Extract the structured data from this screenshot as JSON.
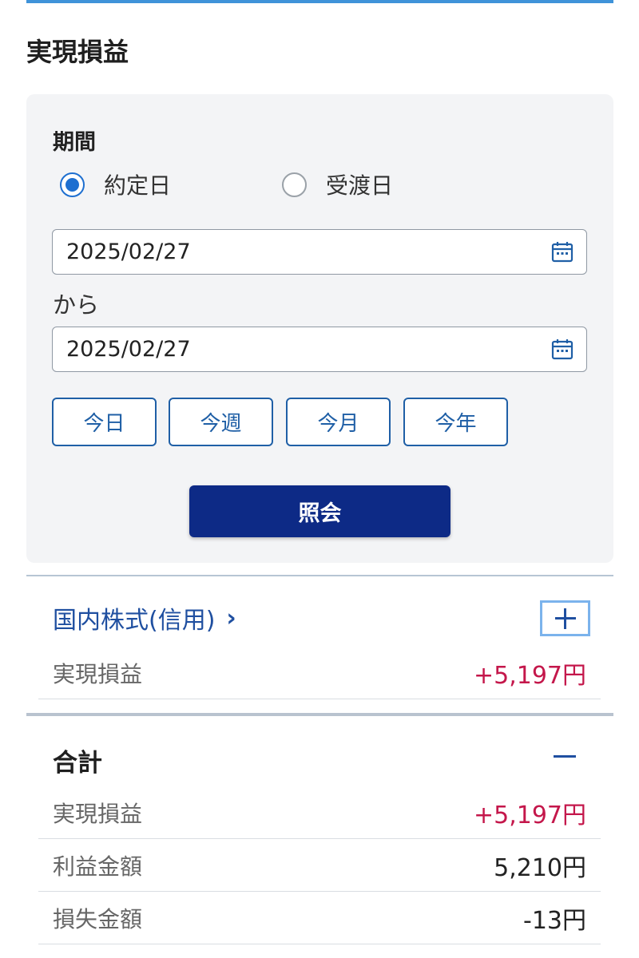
{
  "page": {
    "title": "実現損益"
  },
  "filter": {
    "period_label": "期間",
    "radio_options": [
      {
        "label": "約定日",
        "selected": true
      },
      {
        "label": "受渡日",
        "selected": false
      }
    ],
    "date_from": "2025/02/27",
    "separator": "から",
    "date_to": "2025/02/27",
    "quick_buttons": [
      "今日",
      "今週",
      "今月",
      "今年"
    ],
    "submit_label": "照会"
  },
  "sections": {
    "domestic": {
      "title": "国内株式(信用)",
      "chevron": "›",
      "rows": [
        {
          "label": "実現損益",
          "value": "+5,197円",
          "tone": "positive"
        }
      ]
    },
    "total": {
      "title": "合計",
      "rows": [
        {
          "label": "実現損益",
          "value": "+5,197円",
          "tone": "positive"
        },
        {
          "label": "利益金額",
          "value": "5,210円",
          "tone": "neutral"
        },
        {
          "label": "損失金額",
          "value": "-13円",
          "tone": "neutral"
        }
      ]
    }
  },
  "colors": {
    "accent": "#3f93d9",
    "primary_button": "#0d2a86",
    "link": "#1f4fa0",
    "positive_value": "#c4174b",
    "radio_selected": "#1e6fd0"
  },
  "icons": {
    "date_picker": "calendar-icon",
    "expand": "plus-icon",
    "collapse": "minus-icon"
  }
}
